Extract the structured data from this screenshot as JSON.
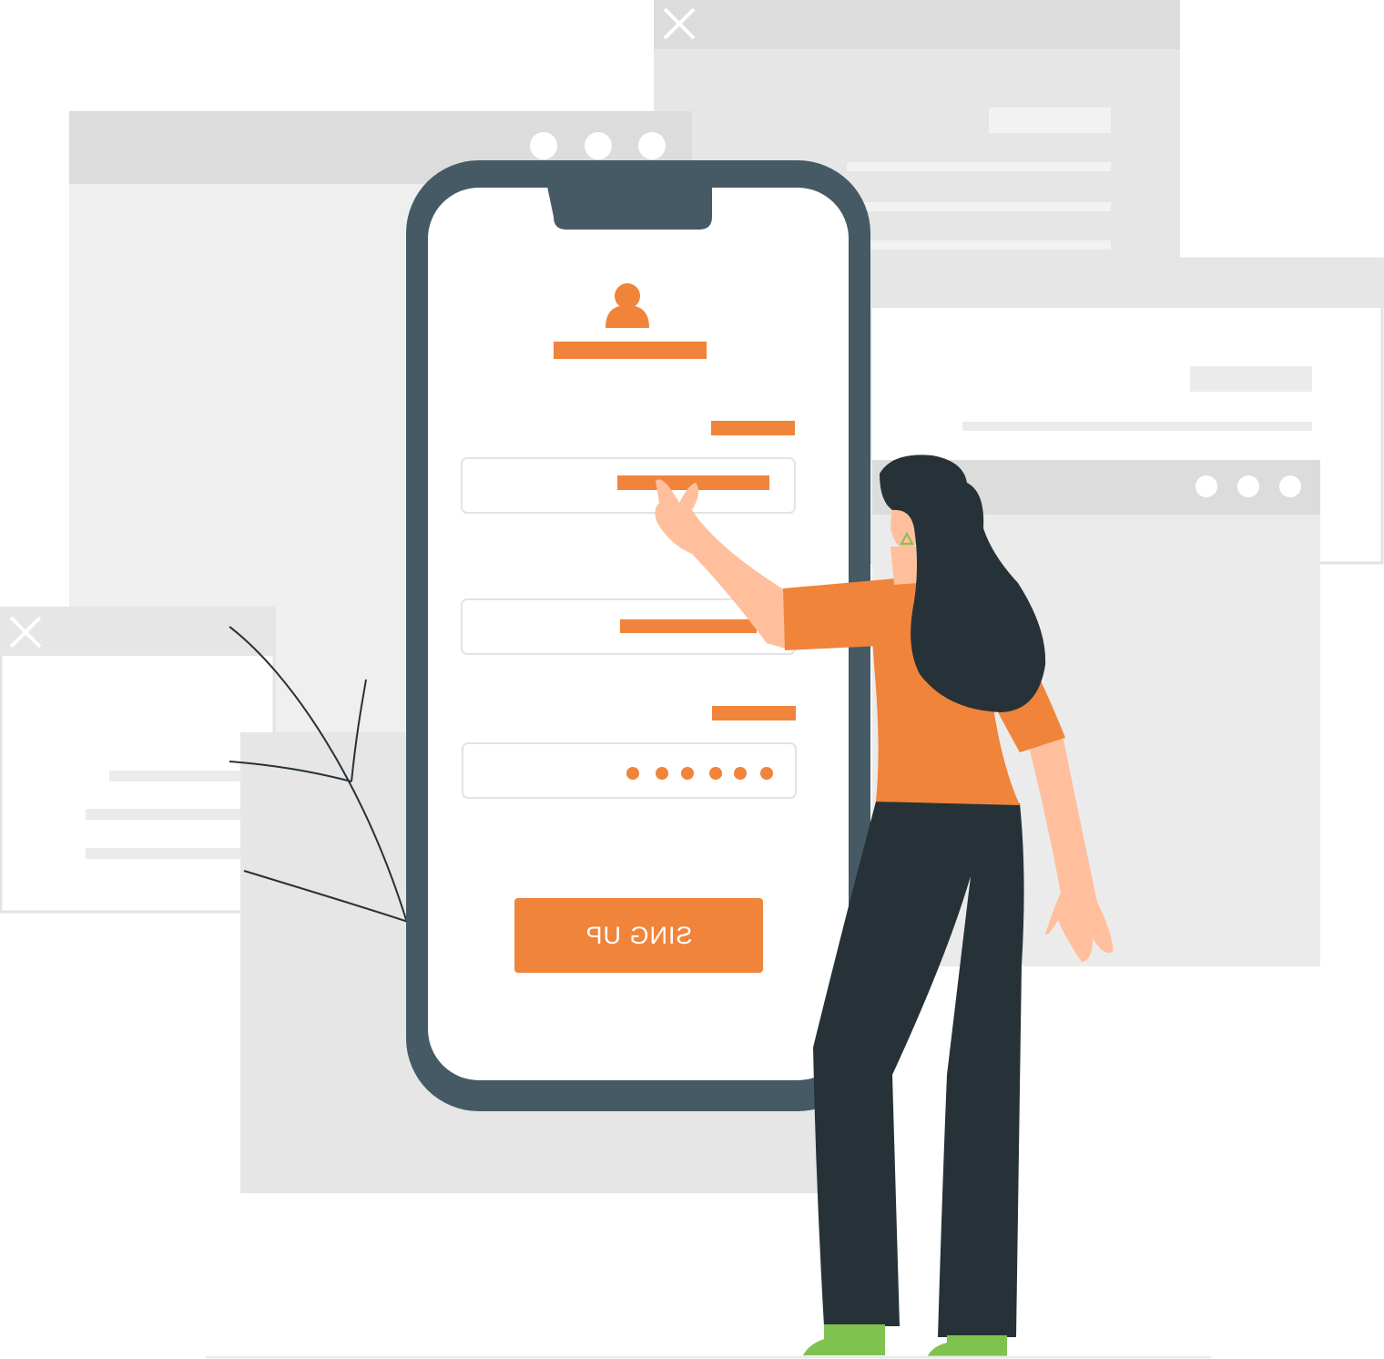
{
  "signup_button": {
    "label": "SING UP"
  },
  "password": {
    "masked_dot_count": 6
  },
  "colors": {
    "accent": "#F0843A",
    "phone_frame": "#455A64",
    "window_gray": "#E6E6E6",
    "window_header": "#DCDCDC",
    "hair_pants": "#263238",
    "skin": "#FFBF9D",
    "shoes": "#7FC24F"
  },
  "icons": [
    "close-icon",
    "user-icon",
    "window-dots-icon"
  ]
}
